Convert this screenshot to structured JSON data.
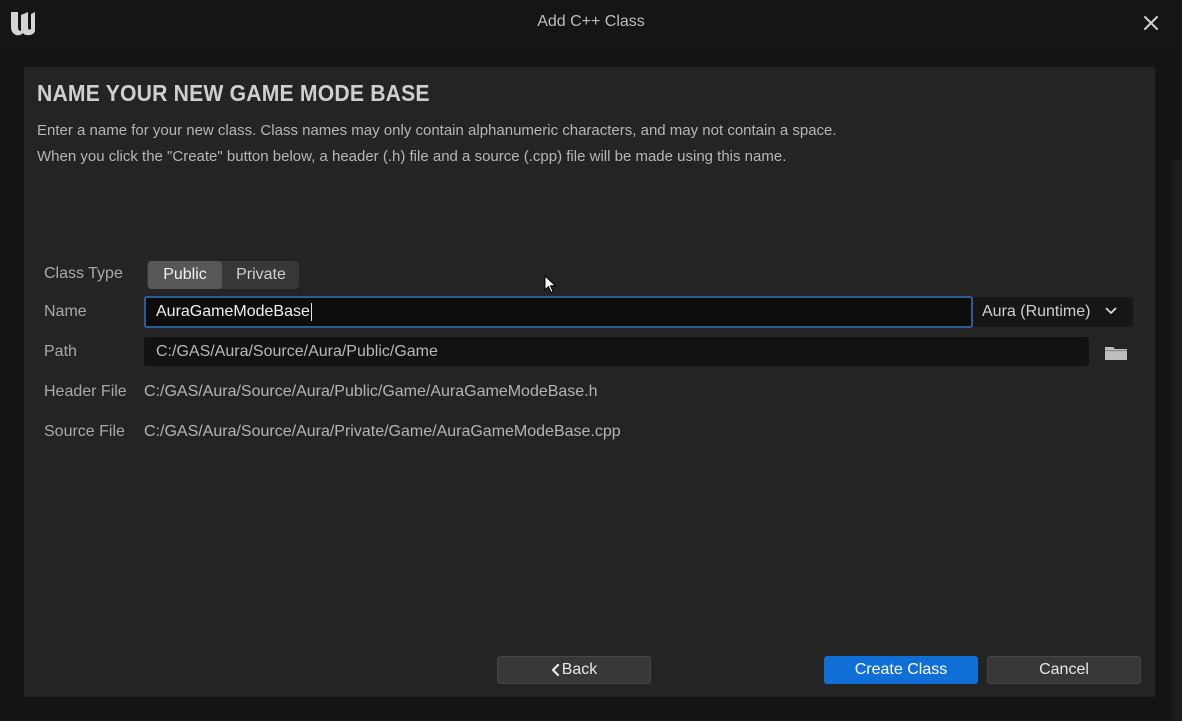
{
  "window": {
    "title": "Add C++ Class",
    "logo_icon": "unreal-engine-logo-icon",
    "close_icon": "close-icon"
  },
  "page": {
    "heading": "NAME YOUR NEW GAME MODE BASE",
    "description_line1": "Enter a name for your new class. Class names may only contain alphanumeric characters, and may not contain a space.",
    "description_line2": "When you click the \"Create\" button below, a header (.h) file and a source (.cpp) file will be made using this name."
  },
  "form": {
    "class_type_label": "Class Type",
    "class_type_options": [
      "Public",
      "Private"
    ],
    "class_type_selected": "Public",
    "name_label": "Name",
    "name_value": "AuraGameModeBase",
    "module_selected": "Aura (Runtime)",
    "path_label": "Path",
    "path_value": "C:/GAS/Aura/Source/Aura/Public/Game",
    "folder_icon": "folder-icon",
    "header_file_label": "Header File",
    "header_file_value": "C:/GAS/Aura/Source/Aura/Public/Game/AuraGameModeBase.h",
    "source_file_label": "Source File",
    "source_file_value": "C:/GAS/Aura/Source/Aura/Private/Game/AuraGameModeBase.cpp"
  },
  "footer": {
    "back_label": "Back",
    "create_label": "Create Class",
    "cancel_label": "Cancel"
  },
  "colors": {
    "primary_button": "#0f6fd6",
    "focus_border": "#2c5d99",
    "panel_background": "#242424",
    "window_background": "#141414"
  }
}
